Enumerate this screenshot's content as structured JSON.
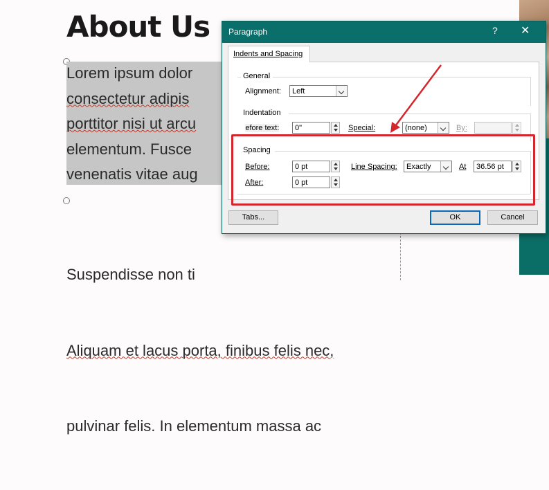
{
  "slide": {
    "title": "About Us",
    "paragraph1": [
      {
        "text": "Lorem ipsum dolor ",
        "spell": false
      },
      {
        "text": "consectetur adipis",
        "spell": true
      },
      {
        "text": "porttitor nisi ut arcu",
        "spell": true
      },
      {
        "text": "elementum. Fusce ",
        "spell": false
      },
      {
        "text": "venenatis vitae aug",
        "spell": false
      }
    ],
    "paragraph2_line1": "Suspendisse non ti",
    "paragraph2_line2": "Aliquam et lacus porta, finibus felis nec,",
    "paragraph2_line3": "pulvinar felis. In elementum massa ac"
  },
  "dialog": {
    "title": "Paragraph",
    "help": "?",
    "close": "✕",
    "tab": "Indents and Spacing",
    "general": {
      "label": "General",
      "alignment_label": "Alignment:",
      "alignment_value": "Left"
    },
    "indentation": {
      "label": "Indentation",
      "before_text_label": "Before text:",
      "before_text_value": "0\"",
      "special_label": "Special:",
      "special_value": "(none)",
      "by_label": "By:",
      "by_value": ""
    },
    "spacing": {
      "label": "Spacing",
      "before_label": "Before:",
      "before_value": "0 pt",
      "after_label": "After:",
      "after_value": "0 pt",
      "line_spacing_label": "Line Spacing:",
      "line_spacing_value": "Exactly",
      "at_label": "At",
      "at_value": "36.56 pt"
    },
    "buttons": {
      "tabs": "Tabs...",
      "ok": "OK",
      "cancel": "Cancel"
    }
  },
  "colors": {
    "titlebar": "#0a6e6a",
    "highlight": "#d4262c"
  },
  "icons": [
    "help-icon",
    "close-icon",
    "chevron-down-icon",
    "spinner-icon",
    "arrow-annotation"
  ]
}
